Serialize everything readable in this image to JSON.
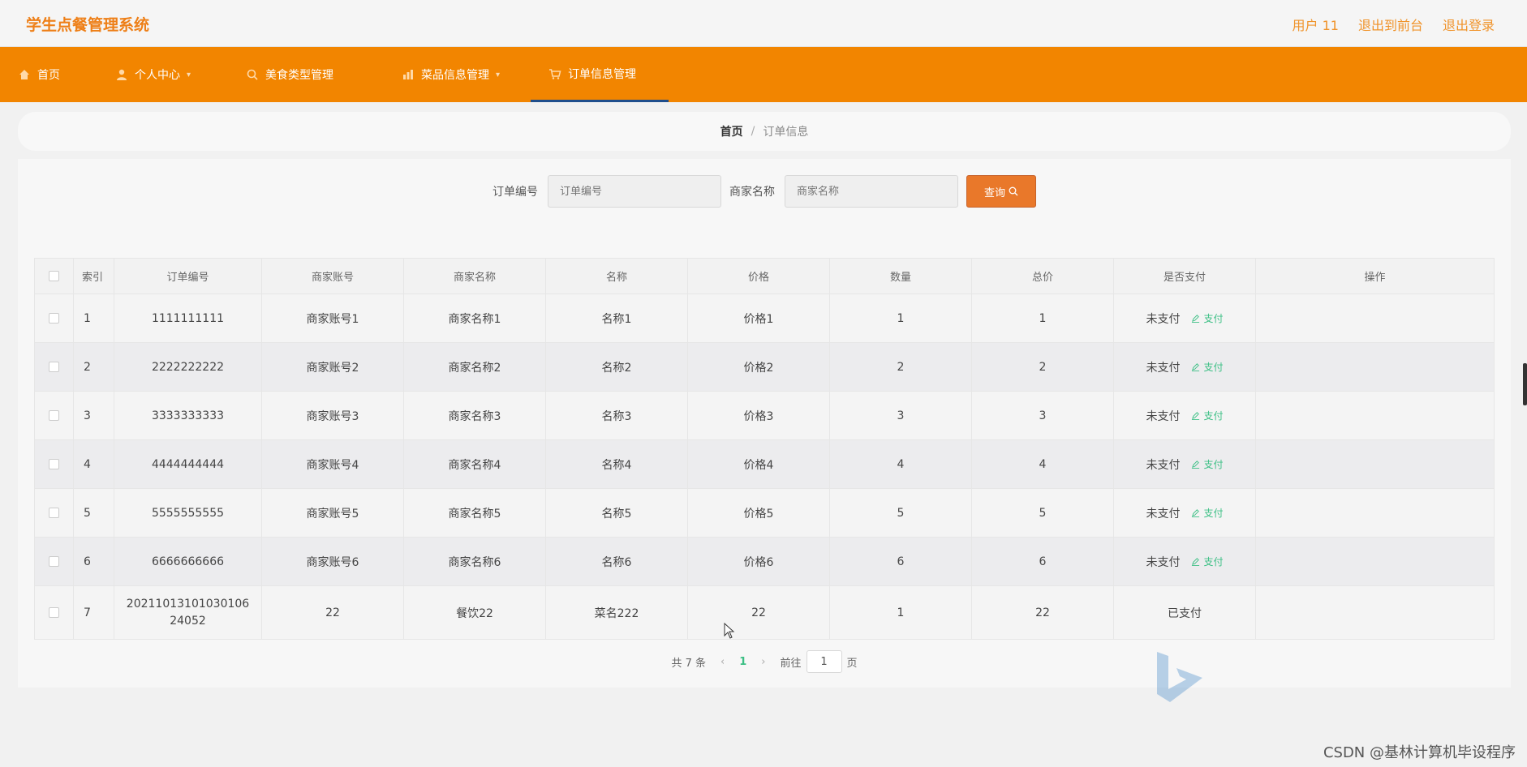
{
  "header": {
    "title": "学生点餐管理系统",
    "links": [
      "用户 11",
      "退出到前台",
      "退出登录"
    ]
  },
  "nav": [
    {
      "label": "首页",
      "icon": "home-icon"
    },
    {
      "label": "个人中心",
      "icon": "user-icon"
    },
    {
      "label": "美食类型管理",
      "icon": "food-icon"
    },
    {
      "label": "菜品信息管理",
      "icon": "dish-icon"
    },
    {
      "label": "订单信息管理",
      "icon": "cart-icon",
      "active": true
    }
  ],
  "breadcrumb": {
    "home": "首页",
    "separator": "/",
    "current": "订单信息"
  },
  "search": {
    "order_label": "订单编号",
    "order_placeholder": "订单编号",
    "merchant_label": "商家名称",
    "merchant_placeholder": "商家名称",
    "button": "查询"
  },
  "table": {
    "columns": [
      "索引",
      "订单编号",
      "商家账号",
      "商家名称",
      "名称",
      "价格",
      "数量",
      "总价",
      "是否支付",
      "操作"
    ],
    "rows": [
      {
        "index": "1",
        "order_no": "1111111111",
        "merchant_account": "商家账号1",
        "merchant_name": "商家名称1",
        "name": "名称1",
        "price": "价格1",
        "qty": "1",
        "total": "1",
        "paid": "未支付",
        "pay_link": "支付"
      },
      {
        "index": "2",
        "order_no": "2222222222",
        "merchant_account": "商家账号2",
        "merchant_name": "商家名称2",
        "name": "名称2",
        "price": "价格2",
        "qty": "2",
        "total": "2",
        "paid": "未支付",
        "pay_link": "支付"
      },
      {
        "index": "3",
        "order_no": "3333333333",
        "merchant_account": "商家账号3",
        "merchant_name": "商家名称3",
        "name": "名称3",
        "price": "价格3",
        "qty": "3",
        "total": "3",
        "paid": "未支付",
        "pay_link": "支付"
      },
      {
        "index": "4",
        "order_no": "4444444444",
        "merchant_account": "商家账号4",
        "merchant_name": "商家名称4",
        "name": "名称4",
        "price": "价格4",
        "qty": "4",
        "total": "4",
        "paid": "未支付",
        "pay_link": "支付"
      },
      {
        "index": "5",
        "order_no": "5555555555",
        "merchant_account": "商家账号5",
        "merchant_name": "商家名称5",
        "name": "名称5",
        "price": "价格5",
        "qty": "5",
        "total": "5",
        "paid": "未支付",
        "pay_link": "支付"
      },
      {
        "index": "6",
        "order_no": "6666666666",
        "merchant_account": "商家账号6",
        "merchant_name": "商家名称6",
        "name": "名称6",
        "price": "价格6",
        "qty": "6",
        "total": "6",
        "paid": "未支付",
        "pay_link": "支付"
      },
      {
        "index": "7",
        "order_no": "2021101310103010624052",
        "merchant_account": "22",
        "merchant_name": "餐饮22",
        "name": "菜名222",
        "price": "22",
        "qty": "1",
        "total": "22",
        "paid": "已支付",
        "pay_link": ""
      }
    ]
  },
  "pager": {
    "total": "共 7 条",
    "current_page": "1",
    "goto_label": "前往",
    "goto_value": "1",
    "page_suffix": "页"
  },
  "watermark": "CSDN @基林计算机毕设程序",
  "colors": {
    "nav_bg": "#f28500",
    "accent": "#e9782a",
    "pay_link": "#3bbf84",
    "title": "#ee7f17"
  }
}
